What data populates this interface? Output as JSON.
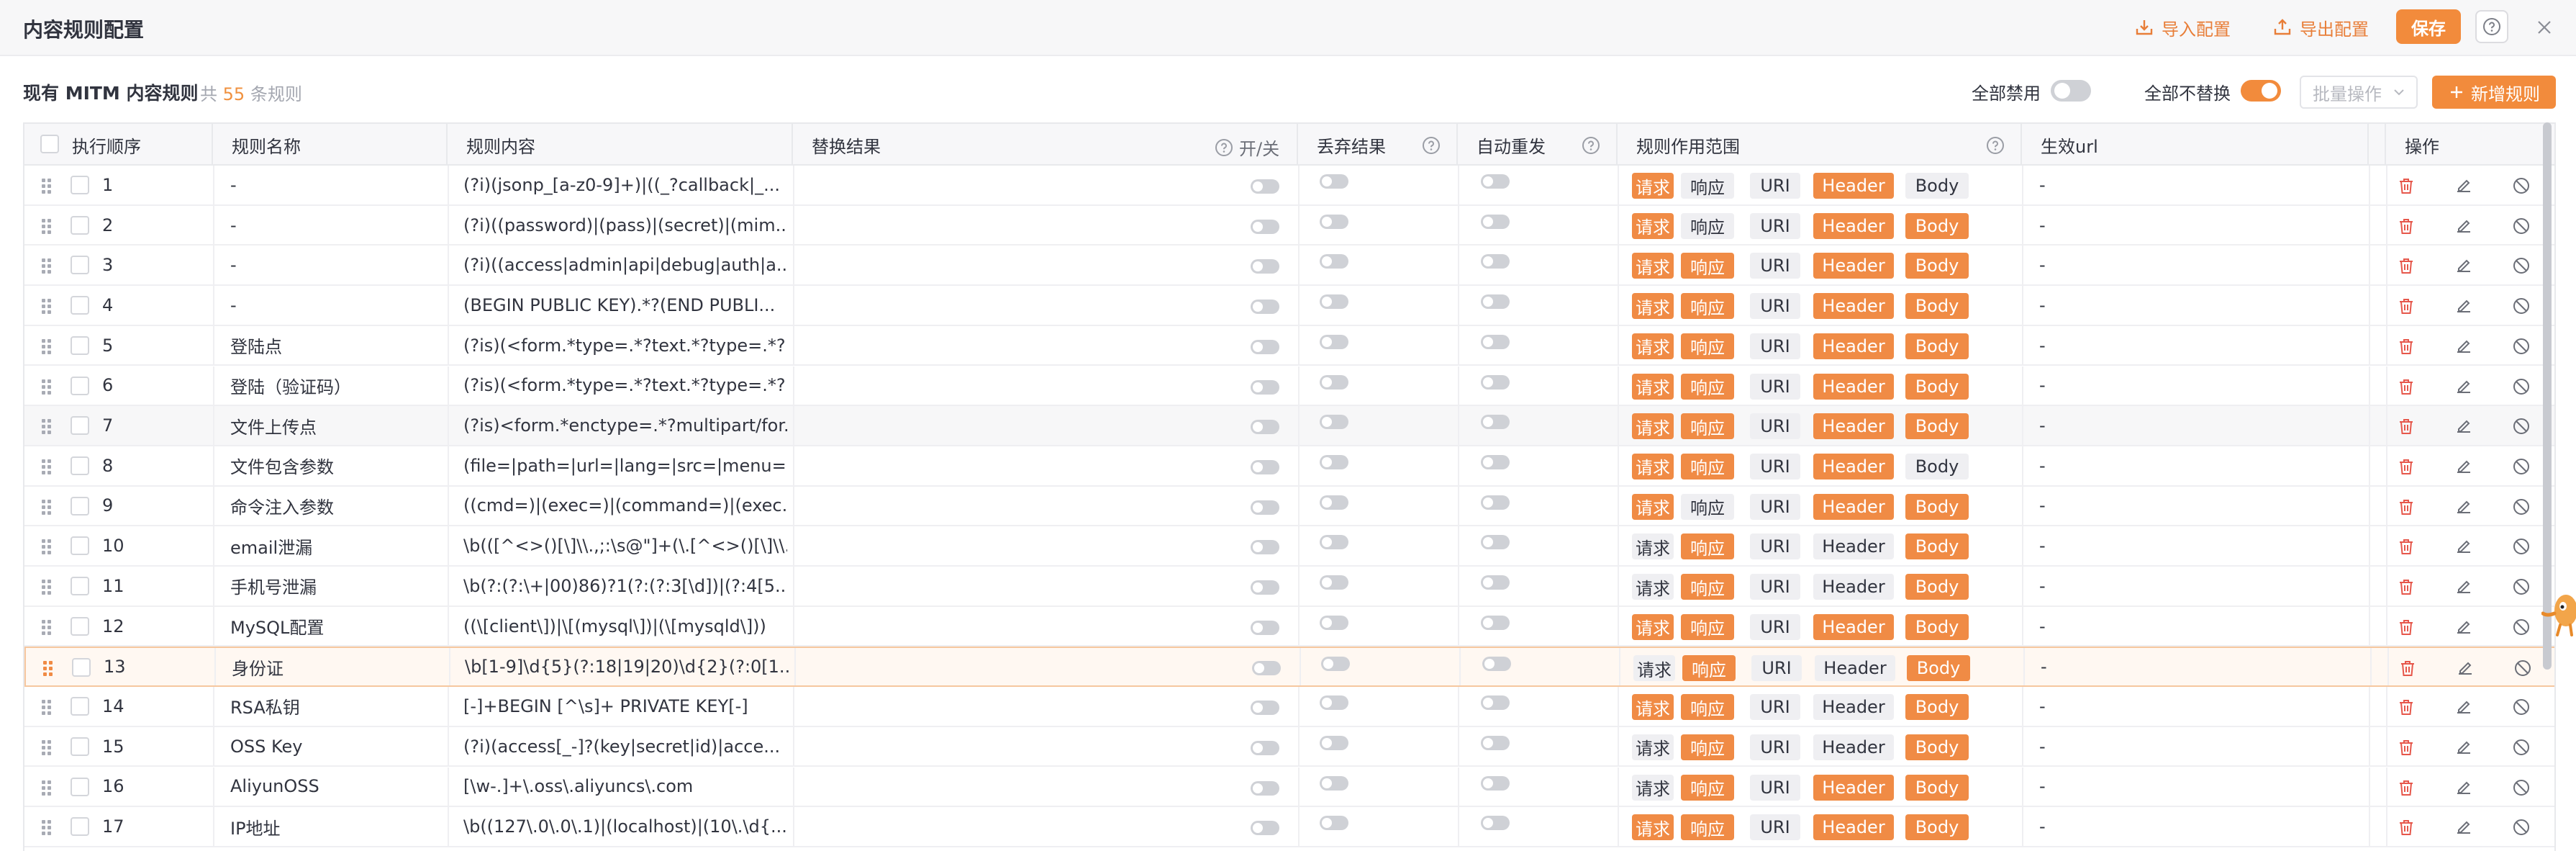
{
  "window": {
    "title": "内容规则配置",
    "import_label": "导入配置",
    "export_label": "导出配置",
    "save_label": "保存"
  },
  "subheader": {
    "label": "现有 MITM 内容规则",
    "count_prefix": "共",
    "count": "55",
    "count_suffix": "条规则",
    "disable_all_label": "全部禁用",
    "disable_all_on": false,
    "no_replace_label": "全部不替换",
    "no_replace_on": true,
    "batch_placeholder": "批量操作",
    "add_label": "新增规则"
  },
  "colors": {
    "accent": "#f28b3c",
    "tag_on": "#f08b45",
    "tag_off": "#efeff2"
  },
  "columns": {
    "order": "执行顺序",
    "name": "规则名称",
    "content": "规则内容",
    "replace": "替换结果",
    "toggle": "开/关",
    "drop": "丢弃结果",
    "resend": "自动重发",
    "scope": "规则作用范围",
    "url": "生效url",
    "ops": "操作"
  },
  "scope_labels": [
    "请求",
    "响应",
    "URI",
    "Header",
    "Body"
  ],
  "rows": [
    {
      "order": "1",
      "name": "-",
      "content": "(?i)(jsonp_[a-z0-9]+)|((_?callback|_...",
      "url": "-",
      "scope": [
        true,
        false,
        false,
        true,
        false
      ]
    },
    {
      "order": "2",
      "name": "-",
      "content": "(?i)((password)|(pass)|(secret)|(mim...",
      "url": "-",
      "scope": [
        true,
        false,
        false,
        true,
        true
      ]
    },
    {
      "order": "3",
      "name": "-",
      "content": "(?i)((access|admin|api|debug|auth|a...",
      "url": "-",
      "scope": [
        true,
        true,
        false,
        true,
        true
      ]
    },
    {
      "order": "4",
      "name": "-",
      "content": "(BEGIN PUBLIC KEY).*?(END PUBLI...",
      "url": "-",
      "scope": [
        true,
        true,
        false,
        true,
        true
      ]
    },
    {
      "order": "5",
      "name": "登陆点",
      "content": "(?is)(<form.*type=.*?text.*?type=.*?...",
      "url": "-",
      "scope": [
        true,
        true,
        false,
        true,
        true
      ]
    },
    {
      "order": "6",
      "name": "登陆（验证码）",
      "content": "(?is)(<form.*type=.*?text.*?type=.*?...",
      "url": "-",
      "scope": [
        true,
        true,
        false,
        true,
        true
      ]
    },
    {
      "order": "7",
      "name": "文件上传点",
      "content": "(?is)<form.*enctype=.*?multipart/for...",
      "url": "-",
      "scope": [
        true,
        true,
        false,
        true,
        true
      ]
    },
    {
      "order": "8",
      "name": "文件包含参数",
      "content": "(file=|path=|url=|lang=|src=|menu=|...",
      "url": "-",
      "scope": [
        true,
        true,
        false,
        true,
        false
      ]
    },
    {
      "order": "9",
      "name": "命令注入参数",
      "content": "((cmd=)|(exec=)|(command=)|(exec...",
      "url": "-",
      "scope": [
        true,
        false,
        false,
        true,
        true
      ]
    },
    {
      "order": "10",
      "name": "email泄漏",
      "content": "\\b(([^<>()[\\]\\\\.,;:\\s@\"]+(\\.[^<>()[\\]\\\\....",
      "url": "-",
      "scope": [
        false,
        true,
        false,
        false,
        true
      ]
    },
    {
      "order": "11",
      "name": "手机号泄漏",
      "content": "\\b(?:(?:\\+|00)86)?1(?:(?:3[\\d])|(?:4[5...",
      "url": "-",
      "scope": [
        false,
        true,
        false,
        false,
        true
      ]
    },
    {
      "order": "12",
      "name": "MySQL配置",
      "content": "((\\[client\\])|\\[(mysql\\])|(\\[mysqld\\]))",
      "url": "-",
      "scope": [
        true,
        true,
        false,
        true,
        true
      ]
    },
    {
      "order": "13",
      "name": "身份证",
      "content": "\\b[1-9]\\d{5}(?:18|19|20)\\d{2}(?:0[1...",
      "url": "-",
      "scope": [
        false,
        true,
        false,
        false,
        true
      ]
    },
    {
      "order": "14",
      "name": "RSA私钥",
      "content": "[-]+BEGIN [^\\s]+ PRIVATE KEY[-]",
      "url": "-",
      "scope": [
        true,
        true,
        false,
        false,
        true
      ]
    },
    {
      "order": "15",
      "name": "OSS Key",
      "content": "(?i)(access[_-]?(key|secret|id)|acce...",
      "url": "-",
      "scope": [
        false,
        true,
        false,
        false,
        true
      ]
    },
    {
      "order": "16",
      "name": "AliyunOSS",
      "content": "[\\w-.]+\\.oss\\.aliyuncs\\.com",
      "url": "-",
      "scope": [
        false,
        true,
        false,
        true,
        true
      ]
    },
    {
      "order": "17",
      "name": "IP地址",
      "content": "\\b((127\\.0\\.0\\.1)|(localhost)|(10\\.\\d{...",
      "url": "-",
      "scope": [
        true,
        true,
        false,
        true,
        true
      ]
    }
  ]
}
